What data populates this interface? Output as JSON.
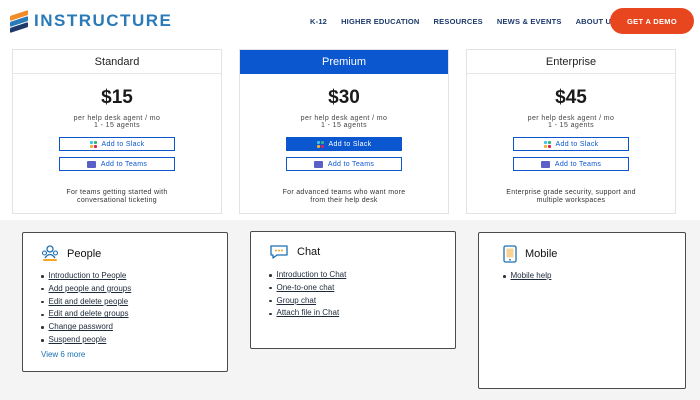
{
  "header": {
    "brand": "INSTRUCTURE",
    "nav": [
      "K-12",
      "HIGHER EDUCATION",
      "RESOURCES",
      "NEWS & EVENTS",
      "ABOUT US"
    ],
    "cta": "GET A DEMO",
    "colors": {
      "brand": "#2a7ab8",
      "cta": "#e8461f",
      "nav": "#1d3a6b"
    }
  },
  "pricing": {
    "plans": [
      {
        "name": "Standard",
        "price": "$15",
        "per": "per help desk agent / mo",
        "agents": "1 - 15 agents",
        "slack": "Add to Slack",
        "teams": "Add to Teams",
        "desc1": "For teams getting started with",
        "desc2": "conversational ticketing"
      },
      {
        "name": "Premium",
        "price": "$30",
        "per": "per help desk agent / mo",
        "agents": "1 - 15 agents",
        "slack": "Add to Slack",
        "teams": "Add to Teams",
        "desc1": "For advanced teams who want more",
        "desc2": "from their help desk"
      },
      {
        "name": "Enterprise",
        "price": "$45",
        "per": "per help desk agent / mo",
        "agents": "1 - 15 agents",
        "slack": "Add to Slack",
        "teams": "Add to Teams",
        "desc1": "Enterprise grade security, support and",
        "desc2": "multiple workspaces"
      }
    ],
    "featured_color": "#0b57d0"
  },
  "help": {
    "people": {
      "title": "People",
      "items": [
        "Introduction to People",
        "Add people and groups",
        "Edit and delete people",
        "Edit and delete groups",
        "Change password",
        "Suspend people"
      ],
      "more": "View 6 more"
    },
    "chat": {
      "title": "Chat",
      "items": [
        "Introduction to Chat",
        "One-to-one chat",
        "Group chat",
        "Attach file in Chat"
      ]
    },
    "mobile": {
      "title": "Mobile",
      "items": [
        "Mobile help"
      ]
    }
  }
}
